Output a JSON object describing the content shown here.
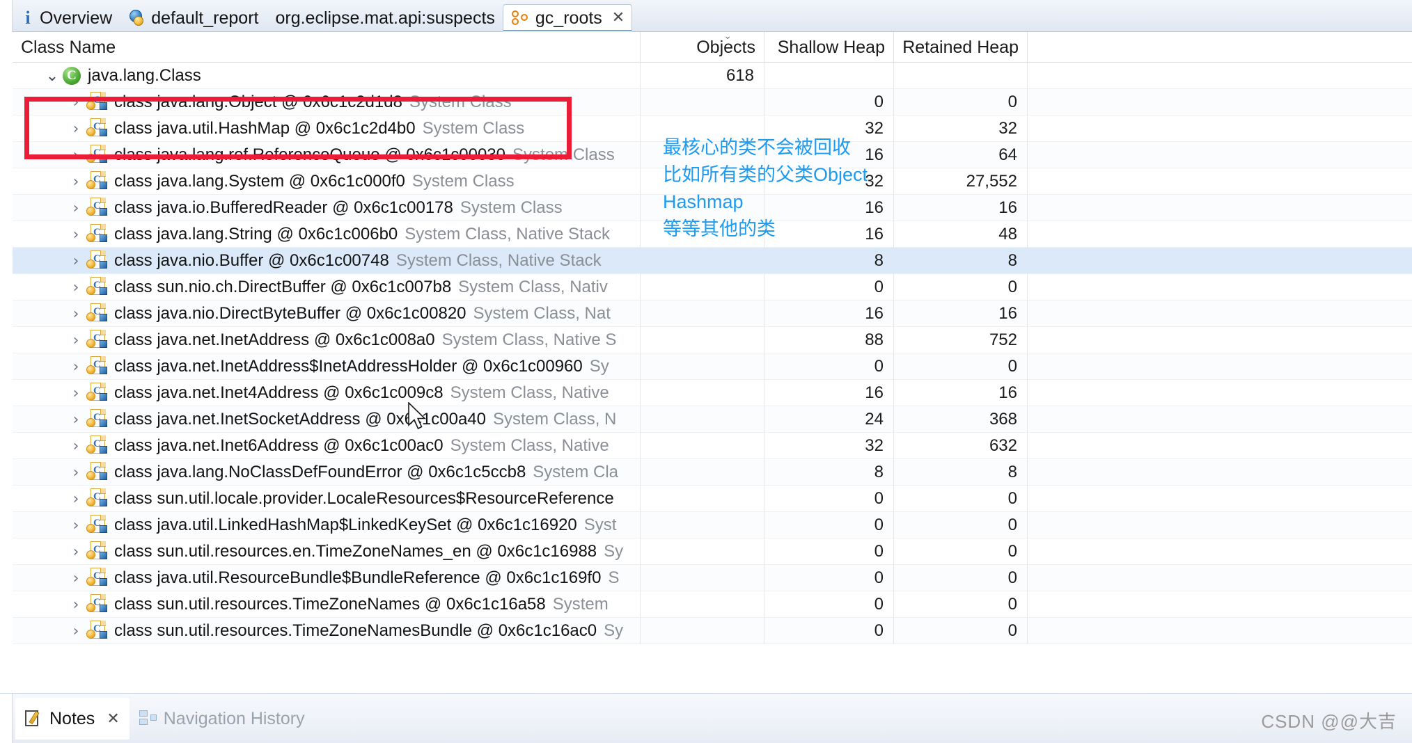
{
  "editor_tabs": [
    {
      "label": "Overview",
      "icon": "info-icon",
      "active": false,
      "closable": false
    },
    {
      "label": "default_report",
      "icon": "report-icon",
      "active": false,
      "closable": false
    },
    {
      "label": "org.eclipse.mat.api:suspects",
      "icon": "none",
      "active": false,
      "closable": false
    },
    {
      "label": "gc_roots",
      "icon": "gc-roots-icon",
      "active": true,
      "closable": true,
      "close_label": "✕"
    }
  ],
  "table": {
    "columns": [
      {
        "key": "name",
        "label": "Class Name",
        "align": "left"
      },
      {
        "key": "objects",
        "label": "Objects",
        "align": "right",
        "sorted": true,
        "sort_mark": "⌄"
      },
      {
        "key": "shallow",
        "label": "Shallow Heap",
        "align": "right"
      },
      {
        "key": "retained",
        "label": "Retained Heap",
        "align": "right"
      }
    ],
    "rows": [
      {
        "indent": 1,
        "twisty": "⌄",
        "icon": "class-green-icon",
        "name": "java.lang.Class",
        "suffix": "",
        "objects": "618",
        "shallow": "",
        "retained": "",
        "selected": false
      },
      {
        "indent": 2,
        "twisty": "›",
        "icon": "class-object-icon",
        "name": "class java.lang.Object @ 0x6c1c2d1d8",
        "suffix": "System Class",
        "objects": "",
        "shallow": "0",
        "retained": "0",
        "selected": false
      },
      {
        "indent": 2,
        "twisty": "›",
        "icon": "class-object-icon",
        "name": "class java.util.HashMap @ 0x6c1c2d4b0",
        "suffix": "System Class",
        "objects": "",
        "shallow": "32",
        "retained": "32",
        "selected": false
      },
      {
        "indent": 2,
        "twisty": "›",
        "icon": "class-object-icon",
        "name": "class java.lang.ref.ReferenceQueue @ 0x6c1c00030",
        "suffix": "System Class",
        "objects": "",
        "shallow": "16",
        "retained": "64",
        "selected": false
      },
      {
        "indent": 2,
        "twisty": "›",
        "icon": "class-object-icon",
        "name": "class java.lang.System @ 0x6c1c000f0",
        "suffix": "System Class",
        "objects": "",
        "shallow": "32",
        "retained": "27,552",
        "selected": false
      },
      {
        "indent": 2,
        "twisty": "›",
        "icon": "class-object-icon",
        "name": "class java.io.BufferedReader @ 0x6c1c00178",
        "suffix": "System Class",
        "objects": "",
        "shallow": "16",
        "retained": "16",
        "selected": false
      },
      {
        "indent": 2,
        "twisty": "›",
        "icon": "class-object-icon",
        "name": "class java.lang.String @ 0x6c1c006b0",
        "suffix": "System Class, Native Stack",
        "objects": "",
        "shallow": "16",
        "retained": "48",
        "selected": false
      },
      {
        "indent": 2,
        "twisty": "›",
        "icon": "class-object-icon",
        "name": "class java.nio.Buffer @ 0x6c1c00748",
        "suffix": "System Class, Native Stack",
        "objects": "",
        "shallow": "8",
        "retained": "8",
        "selected": true
      },
      {
        "indent": 2,
        "twisty": "›",
        "icon": "class-object-icon",
        "name": "class sun.nio.ch.DirectBuffer @ 0x6c1c007b8",
        "suffix": "System Class, Nativ",
        "objects": "",
        "shallow": "0",
        "retained": "0",
        "selected": false
      },
      {
        "indent": 2,
        "twisty": "›",
        "icon": "class-object-icon",
        "name": "class java.nio.DirectByteBuffer @ 0x6c1c00820",
        "suffix": "System Class, Nat",
        "objects": "",
        "shallow": "16",
        "retained": "16",
        "selected": false
      },
      {
        "indent": 2,
        "twisty": "›",
        "icon": "class-object-icon",
        "name": "class java.net.InetAddress @ 0x6c1c008a0",
        "suffix": "System Class, Native S",
        "objects": "",
        "shallow": "88",
        "retained": "752",
        "selected": false
      },
      {
        "indent": 2,
        "twisty": "›",
        "icon": "class-object-icon",
        "name": "class java.net.InetAddress$InetAddressHolder @ 0x6c1c00960",
        "suffix": "Sy",
        "objects": "",
        "shallow": "0",
        "retained": "0",
        "selected": false
      },
      {
        "indent": 2,
        "twisty": "›",
        "icon": "class-object-icon",
        "name": "class java.net.Inet4Address @ 0x6c1c009c8",
        "suffix": "System Class, Native",
        "objects": "",
        "shallow": "16",
        "retained": "16",
        "selected": false
      },
      {
        "indent": 2,
        "twisty": "›",
        "icon": "class-object-icon",
        "name": "class java.net.InetSocketAddress @ 0x6c1c00a40",
        "suffix": "System Class, N",
        "objects": "",
        "shallow": "24",
        "retained": "368",
        "selected": false
      },
      {
        "indent": 2,
        "twisty": "›",
        "icon": "class-object-icon",
        "name": "class java.net.Inet6Address @ 0x6c1c00ac0",
        "suffix": "System Class, Native",
        "objects": "",
        "shallow": "32",
        "retained": "632",
        "selected": false
      },
      {
        "indent": 2,
        "twisty": "›",
        "icon": "class-object-icon",
        "name": "class java.lang.NoClassDefFoundError @ 0x6c1c5ccb8",
        "suffix": "System Cla",
        "objects": "",
        "shallow": "8",
        "retained": "8",
        "selected": false
      },
      {
        "indent": 2,
        "twisty": "›",
        "icon": "class-object-icon",
        "name": "class sun.util.locale.provider.LocaleResources$ResourceReference",
        "suffix": "",
        "objects": "",
        "shallow": "0",
        "retained": "0",
        "selected": false
      },
      {
        "indent": 2,
        "twisty": "›",
        "icon": "class-object-icon",
        "name": "class java.util.LinkedHashMap$LinkedKeySet @ 0x6c1c16920",
        "suffix": "Syst",
        "objects": "",
        "shallow": "0",
        "retained": "0",
        "selected": false
      },
      {
        "indent": 2,
        "twisty": "›",
        "icon": "class-object-icon",
        "name": "class sun.util.resources.en.TimeZoneNames_en @ 0x6c1c16988",
        "suffix": "Sy",
        "objects": "",
        "shallow": "0",
        "retained": "0",
        "selected": false
      },
      {
        "indent": 2,
        "twisty": "›",
        "icon": "class-object-icon",
        "name": "class java.util.ResourceBundle$BundleReference @ 0x6c1c169f0",
        "suffix": "S",
        "objects": "",
        "shallow": "0",
        "retained": "0",
        "selected": false
      },
      {
        "indent": 2,
        "twisty": "›",
        "icon": "class-object-icon",
        "name": "class sun.util.resources.TimeZoneNames @ 0x6c1c16a58",
        "suffix": "System",
        "objects": "",
        "shallow": "0",
        "retained": "0",
        "selected": false
      },
      {
        "indent": 2,
        "twisty": "›",
        "icon": "class-object-icon",
        "name": "class sun.util.resources.TimeZoneNamesBundle @ 0x6c1c16ac0",
        "suffix": "Sy",
        "objects": "",
        "shallow": "0",
        "retained": "0",
        "selected": false
      }
    ]
  },
  "annotations": {
    "highlight_box_color": "#ec1c38",
    "note_color": "#1c9bf0",
    "note_lines": [
      "最核心的类不会被回收",
      "比如所有类的父类Object",
      "Hashmap",
      "等等其他的类"
    ]
  },
  "bottom_tabs": [
    {
      "label": "Notes",
      "icon": "notes-icon",
      "active": true,
      "closable": true,
      "close_label": "✕"
    },
    {
      "label": "Navigation History",
      "icon": "navigation-history-icon",
      "active": false,
      "closable": false
    }
  ],
  "watermark": "CSDN @@大吉"
}
